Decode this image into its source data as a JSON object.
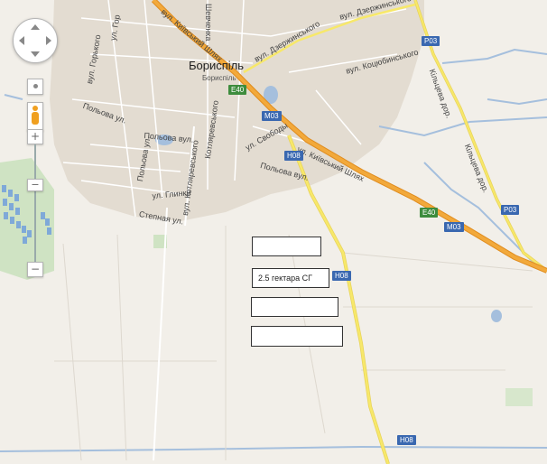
{
  "map": {
    "city_name": "Бориспіль",
    "city_name_local": "Бориспіль",
    "streets": [
      "вул. Київський Шлях",
      "вул. Дзержинського",
      "вул. Дзержинського",
      "вул. Коцюбинського",
      "вул. Горького",
      "ул. Гор",
      "Шевченка",
      "Польова ул.",
      "Польова вул.",
      "ул. Свободы",
      "Польова вул.",
      "Польова ул.",
      "ул. Глинки",
      "Степная ул.",
      "вул. Котляревського",
      "Котляревського",
      "Кільцева дор.",
      "Кільцева дор.",
      "ул. Київський Шлях"
    ],
    "route_shields": [
      {
        "label": "E40",
        "color": "#3d8c3d"
      },
      {
        "label": "M03",
        "color": "#3a68b0"
      },
      {
        "label": "H08",
        "color": "#3a68b0"
      },
      {
        "label": "P03",
        "color": "#3a68b0"
      },
      {
        "label": "E40",
        "color": "#3d8c3d"
      },
      {
        "label": "M03",
        "color": "#3a68b0"
      },
      {
        "label": "P03",
        "color": "#3a68b0"
      },
      {
        "label": "H08",
        "color": "#3a68b0"
      },
      {
        "label": "H08",
        "color": "#3a68b0"
      }
    ],
    "annotation_boxes": [
      "",
      "2.5 гектара СГ",
      "",
      ""
    ]
  },
  "controls": {
    "zoom_in": "+",
    "zoom_out": "−",
    "slider_mark": "−"
  },
  "colors": {
    "highway": "#f2a93b",
    "secondary_road": "#f7e86a",
    "water": "#a5bfdd",
    "urban": "#e3dcd1",
    "land": "#f2efe9"
  }
}
